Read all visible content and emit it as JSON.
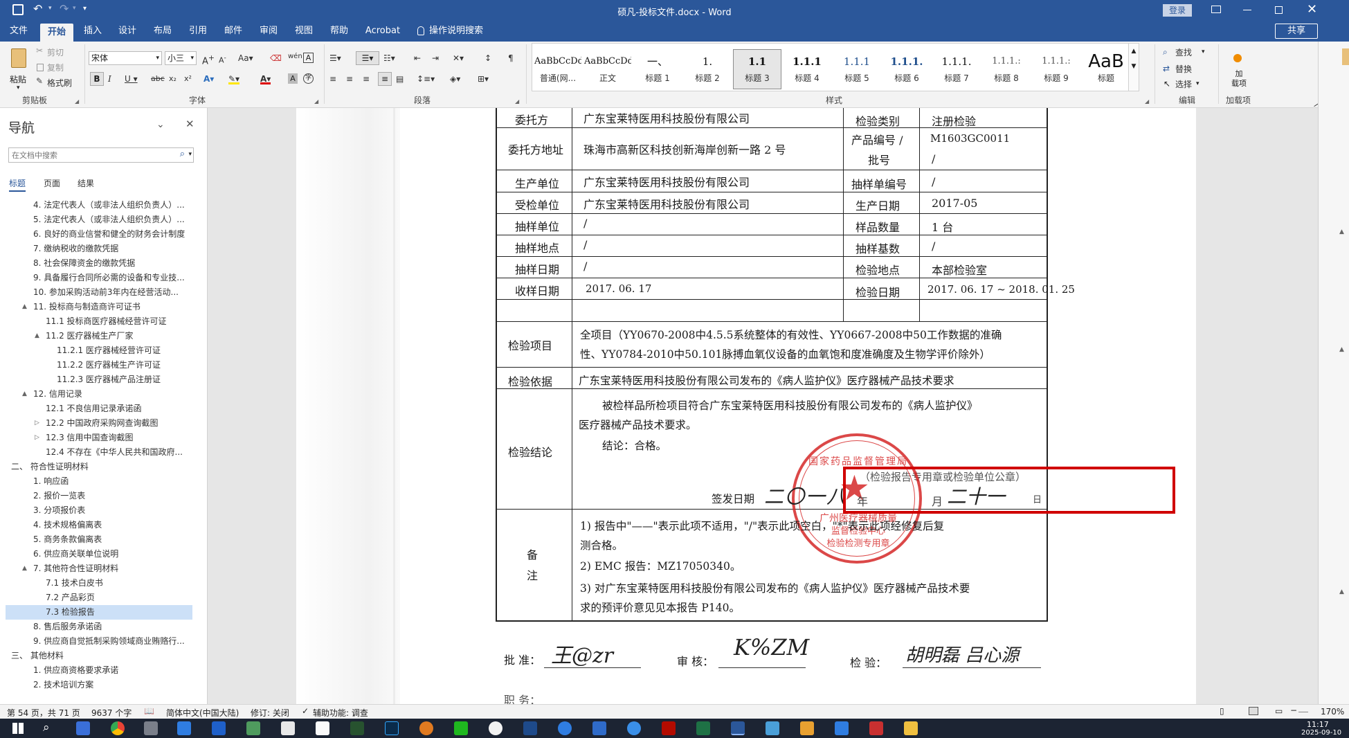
{
  "titlebar": {
    "doc_title": "硕凡-投标文件.docx  -  Word",
    "login_label": "登录"
  },
  "tabs": [
    {
      "label": "文件"
    },
    {
      "label": "开始"
    },
    {
      "label": "插入"
    },
    {
      "label": "设计"
    },
    {
      "label": "布局"
    },
    {
      "label": "引用"
    },
    {
      "label": "邮件"
    },
    {
      "label": "审阅"
    },
    {
      "label": "视图"
    },
    {
      "label": "帮助"
    },
    {
      "label": "Acrobat"
    },
    {
      "label": "操作说明搜索"
    }
  ],
  "share_label": "共享",
  "ribbon": {
    "clipboard": {
      "paste": "粘贴",
      "cut": "剪切",
      "copy": "复制",
      "format_painter": "格式刷",
      "group": "剪贴板"
    },
    "font": {
      "name": "宋体",
      "size": "小三",
      "group": "字体"
    },
    "paragraph": {
      "group": "段落"
    },
    "styles": {
      "group": "样式",
      "items": [
        {
          "sample": "AaBbCcDd",
          "name": "普通(网..."
        },
        {
          "sample": "AaBbCcDdI",
          "name": "正文"
        },
        {
          "sample": "一、",
          "name": "标题 1"
        },
        {
          "sample": "1.",
          "name": "标题 2"
        },
        {
          "sample": "1.1",
          "name": "标题 3"
        },
        {
          "sample": "1.1.1",
          "name": "标题 4"
        },
        {
          "sample": "1.1.1",
          "name": "标题 5"
        },
        {
          "sample": "1.1.1.",
          "name": "标题 6"
        },
        {
          "sample": "1.1.1.",
          "name": "标题 7"
        },
        {
          "sample": "1.1.1.:",
          "name": "标题 8"
        },
        {
          "sample": "1.1.1.:",
          "name": "标题 9"
        },
        {
          "sample": "AaB",
          "name": "标题"
        }
      ]
    },
    "editing": {
      "find": "查找",
      "replace": "替换",
      "select": "选择",
      "group": "编辑"
    },
    "addins": {
      "label": "加载项",
      "group": "加载项"
    }
  },
  "nav": {
    "title": "导航",
    "search_placeholder": "在文档中搜索",
    "tabs": [
      "标题",
      "页面",
      "结果"
    ],
    "items": [
      {
        "text": "4. 法定代表人（或非法人组织负责人）...",
        "level": 2,
        "tw": ""
      },
      {
        "text": "5. 法定代表人（或非法人组织负责人）...",
        "level": 2,
        "tw": ""
      },
      {
        "text": "6. 良好的商业信誉和健全的财务会计制度",
        "level": 2,
        "tw": ""
      },
      {
        "text": "7. 缴纳税收的缴款凭据",
        "level": 2,
        "tw": ""
      },
      {
        "text": "8. 社会保障资金的缴款凭据",
        "level": 2,
        "tw": ""
      },
      {
        "text": "9. 具备履行合同所必需的设备和专业技...",
        "level": 2,
        "tw": ""
      },
      {
        "text": "10. 参加采购活动前3年内在经营活动...",
        "level": 2,
        "tw": ""
      },
      {
        "text": "11. 投标商与制造商许可证书",
        "level": 2,
        "tw": "▲"
      },
      {
        "text": "11.1 投标商医疗器械经营许可证",
        "level": 3,
        "tw": ""
      },
      {
        "text": "11.2 医疗器械生产厂家",
        "level": 3,
        "tw": "▲"
      },
      {
        "text": "11.2.1 医疗器械经营许可证",
        "level": 4,
        "tw": ""
      },
      {
        "text": "11.2.2 医疗器械生产许可证",
        "level": 4,
        "tw": ""
      },
      {
        "text": "11.2.3 医疗器械产品注册证",
        "level": 4,
        "tw": ""
      },
      {
        "text": "12. 信用记录",
        "level": 2,
        "tw": "▲"
      },
      {
        "text": "12.1 不良信用记录承诺函",
        "level": 3,
        "tw": ""
      },
      {
        "text": "12.2 中国政府采购网查询截图",
        "level": 3,
        "tw": "▷"
      },
      {
        "text": "12.3 信用中国查询截图",
        "level": 3,
        "tw": "▷"
      },
      {
        "text": "12.4 不存在《中华人民共和国政府...",
        "level": 3,
        "tw": ""
      },
      {
        "text": "二、 符合性证明材料",
        "level": 1,
        "tw": "▲"
      },
      {
        "text": "1. 响应函",
        "level": 2,
        "tw": ""
      },
      {
        "text": "2. 报价一览表",
        "level": 2,
        "tw": ""
      },
      {
        "text": "3. 分项报价表",
        "level": 2,
        "tw": ""
      },
      {
        "text": "4. 技术规格偏离表",
        "level": 2,
        "tw": ""
      },
      {
        "text": "5. 商务条款偏离表",
        "level": 2,
        "tw": ""
      },
      {
        "text": "6. 供应商关联单位说明",
        "level": 2,
        "tw": ""
      },
      {
        "text": "7. 其他符合性证明材料",
        "level": 2,
        "tw": "▲"
      },
      {
        "text": "7.1 技术白皮书",
        "level": 3,
        "tw": ""
      },
      {
        "text": "7.2 产品彩页",
        "level": 3,
        "tw": ""
      },
      {
        "text": "7.3 检验报告",
        "level": 3,
        "tw": "",
        "selected": true
      },
      {
        "text": "8. 售后服务承诺函",
        "level": 2,
        "tw": ""
      },
      {
        "text": "9. 供应商自觉抵制采购领域商业贿赂行...",
        "level": 2,
        "tw": ""
      },
      {
        "text": "三、 其他材料",
        "level": 1,
        "tw": "▲"
      },
      {
        "text": "1. 供应商资格要求承诺",
        "level": 2,
        "tw": ""
      },
      {
        "text": "2. 技术培训方案",
        "level": 2,
        "tw": ""
      }
    ]
  },
  "doc": {
    "r1": [
      "委托方",
      "广东宝莱特医用科技股份有限公司",
      "检验类别",
      "注册检验"
    ],
    "r2": [
      "委托方地址",
      "珠海市高新区科技创新海岸创新一路 2 号",
      "产品编号 /",
      "批号",
      "M1603GC0011",
      "/"
    ],
    "r3": [
      "生产单位",
      "广东宝莱特医用科技股份有限公司",
      "抽样单编号",
      "/"
    ],
    "r4": [
      "受检单位",
      "广东宝莱特医用科技股份有限公司",
      "生产日期",
      "2017-05"
    ],
    "r5": [
      "抽样单位",
      "/",
      "样品数量",
      "1 台"
    ],
    "r6": [
      "抽样地点",
      "/",
      "抽样基数",
      "/"
    ],
    "r7": [
      "抽样日期",
      "/",
      "检验地点",
      "本部检验室"
    ],
    "r8": [
      "收样日期",
      "2017. 06. 17",
      "检验日期",
      "2017. 06. 17 ~ 2018. 01. 25"
    ],
    "items_label": "检验项目",
    "items_line1": "全项目（YY0670-2008中4.5.5系统整体的有效性、YY0667-2008中50工作数据的准确",
    "items_line2": "性、YY0784-2010中50.101脉搏血氧仪设备的血氧饱和度准确度及生物学评价除外）",
    "basis_label": "检验依据",
    "basis_text": "广东宝莱特医用科技股份有限公司发布的《病人监护仪》医疗器械产品技术要求",
    "conclusion_label": "检验结论",
    "conclusion_line1": "被检样品所检项目符合广东宝莱特医用科技股份有限公司发布的《病人监护仪》",
    "conclusion_line2": "医疗器械产品技术要求。",
    "conclusion_result": "结论：合格。",
    "seal_note": "（检验报告专用章或检验单位公章）",
    "issue_label": "签发日期",
    "issue_year": "二〇一八",
    "year_char": "年",
    "month_char": "月",
    "day_value": "二十一",
    "day_char": "日",
    "remarks_label1": "备",
    "remarks_label2": "注",
    "remarks_1a": "1) 报告中\"——\"表示此项不适用，\"/\"表示此项空白，\"*\"表示此项经修复后复",
    "remarks_1b": "测合格。",
    "remarks_2": "2) EMC 报告：MZ17050340。",
    "remarks_3a": "3) 对广东宝莱特医用科技股份有限公司发布的《病人监护仪》医疗器械产品技术要",
    "remarks_3b": "求的预评价意见见本报告 P140。",
    "approve_label": "批 准：",
    "review_label": "审 核：",
    "inspect_label": "检 验：",
    "sig_approve": "王@zr",
    "sig_review": "K%ZM",
    "sig_inspect": "胡明磊 吕心源",
    "stamp_top": "国家药品监督管理局",
    "stamp_mid": "广州医疗器械质量",
    "stamp_bot": "监督检验中心",
    "stamp_bottom2": "检验检测专用章",
    "bottom_label": "职 务："
  },
  "status": {
    "page": "第 54 页，共 71 页",
    "words": "9637 个字",
    "lang": "简体中文(中国大陆)",
    "track": "修订: 关闭",
    "access": "辅助功能: 调查",
    "zoom": "170%"
  },
  "taskbar": {
    "time": "11:17",
    "date": "2025-09-10"
  },
  "colors": {
    "word_blue": "#2b579a",
    "stamp_red": "#d42020",
    "highlight_red": "#d00000"
  }
}
